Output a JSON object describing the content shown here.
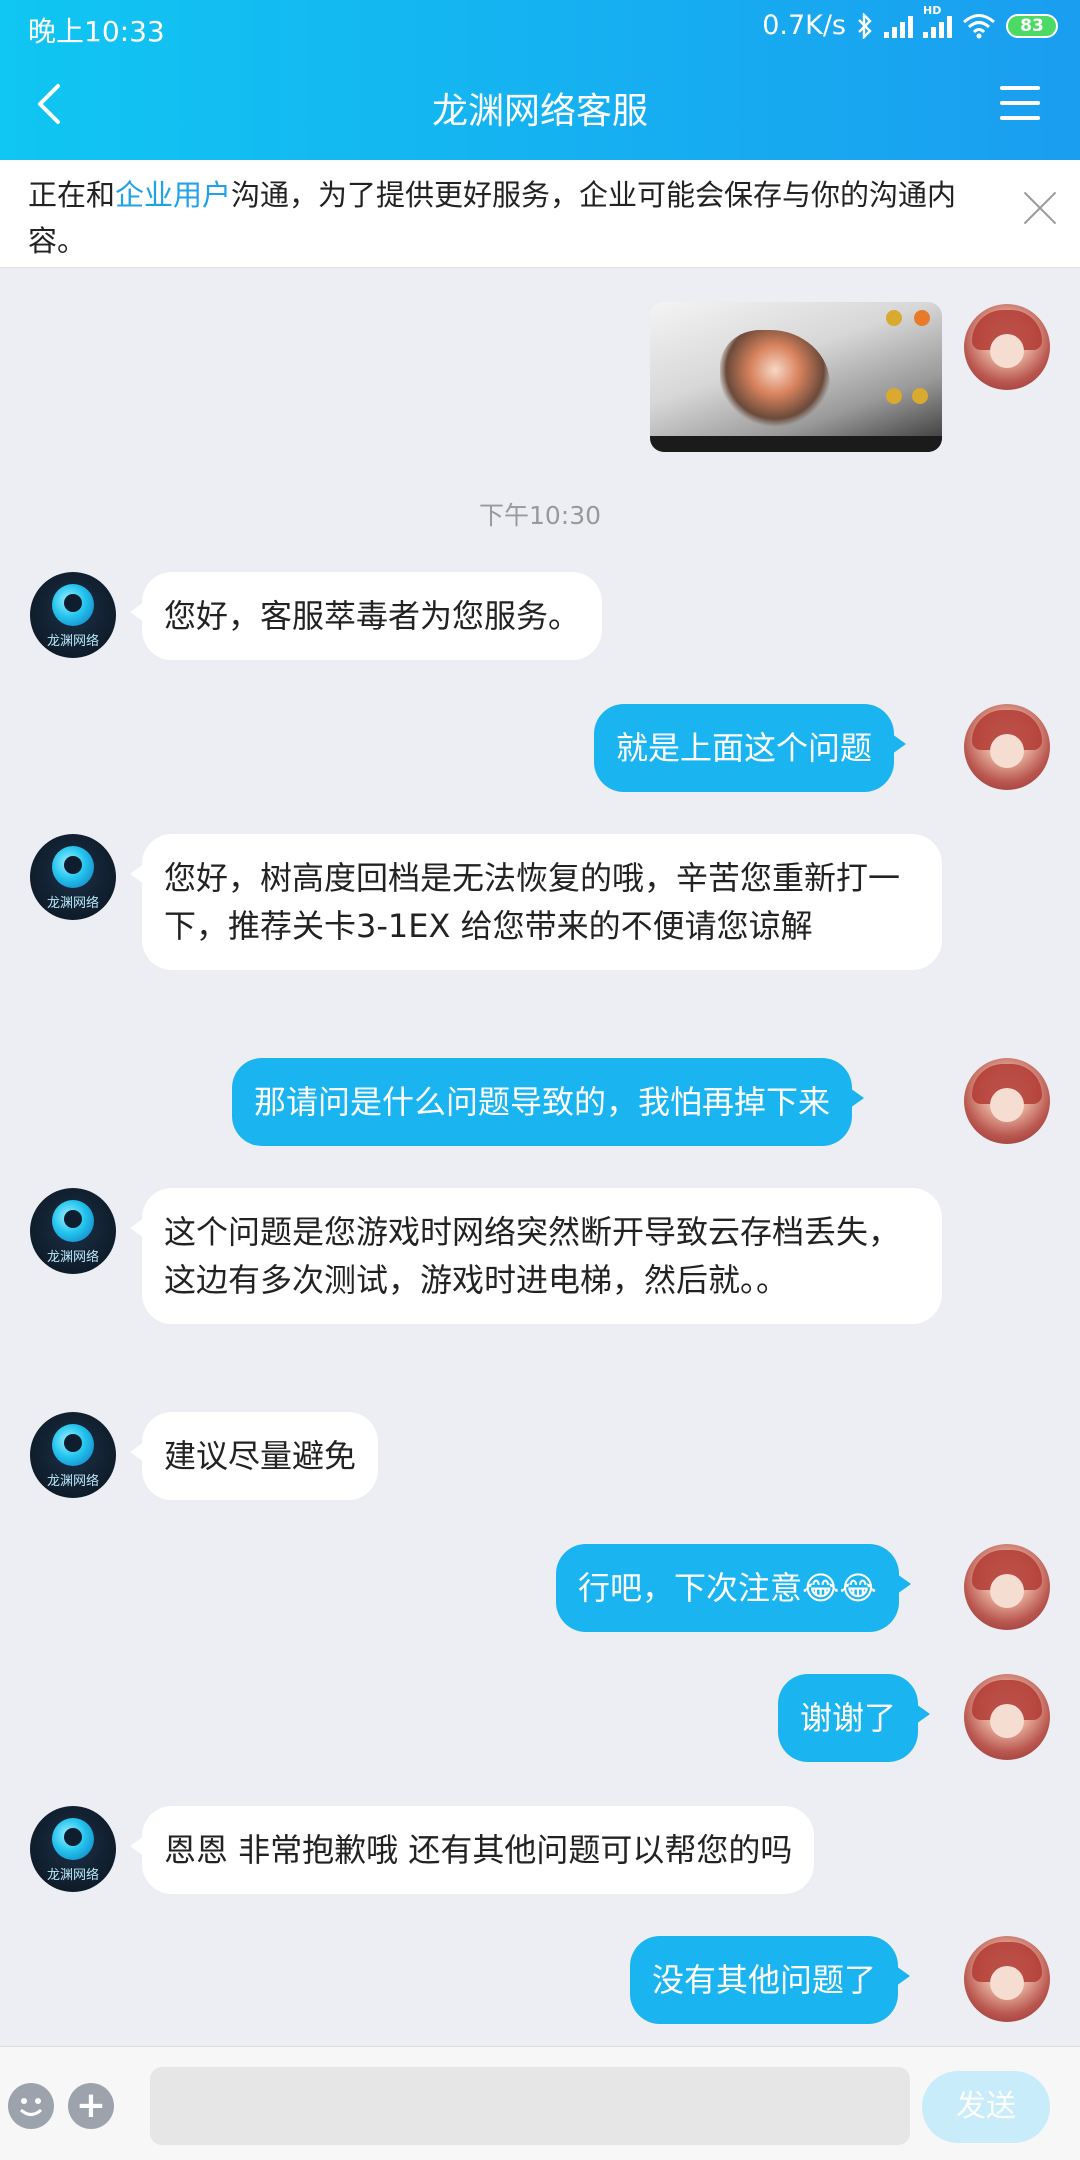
{
  "status_bar": {
    "time": "晚上10:33",
    "net_speed": "0.7K/s",
    "hd": "HD",
    "battery": "83"
  },
  "header": {
    "title": "龙渊网络客服"
  },
  "notice": {
    "prefix": "正在和",
    "link": "企业用户",
    "suffix": "沟通，为了提供更好服务，企业可能会保存与你的沟通内容。"
  },
  "chat": {
    "timestamp": "下午10:30",
    "bot_avatar_label": "龙渊网络",
    "messages": [
      {
        "from": "bot",
        "text": "您好，客服萃毒者为您服务。"
      },
      {
        "from": "user",
        "text": "就是上面这个问题"
      },
      {
        "from": "bot",
        "text": "您好，树高度回档是无法恢复的哦，辛苦您重新打一下，推荐关卡3-1EX  给您带来的不便请您谅解"
      },
      {
        "from": "user",
        "text": "那请问是什么问题导致的，我怕再掉下来"
      },
      {
        "from": "bot",
        "text": "这个问题是您游戏时网络突然断开导致云存档丢失，这边有多次测试，游戏时进电梯，然后就。。"
      },
      {
        "from": "bot",
        "text": "建议尽量避免"
      },
      {
        "from": "user",
        "text": "行吧，下次注意",
        "emoji": "😂😂"
      },
      {
        "from": "user",
        "text": "谢谢了"
      },
      {
        "from": "bot",
        "text": "恩恩 非常抱歉哦  还有其他问题可以帮您的吗"
      },
      {
        "from": "user",
        "text": "没有其他问题了"
      }
    ]
  },
  "input_bar": {
    "send_label": "发送",
    "input_value": ""
  },
  "colors": {
    "header_start": "#10c6f2",
    "header_end": "#1a9ef0",
    "user_bubble": "#1ab4f0",
    "bot_bubble": "#ffffff",
    "background": "#eceef3",
    "link": "#1fa2e8"
  }
}
